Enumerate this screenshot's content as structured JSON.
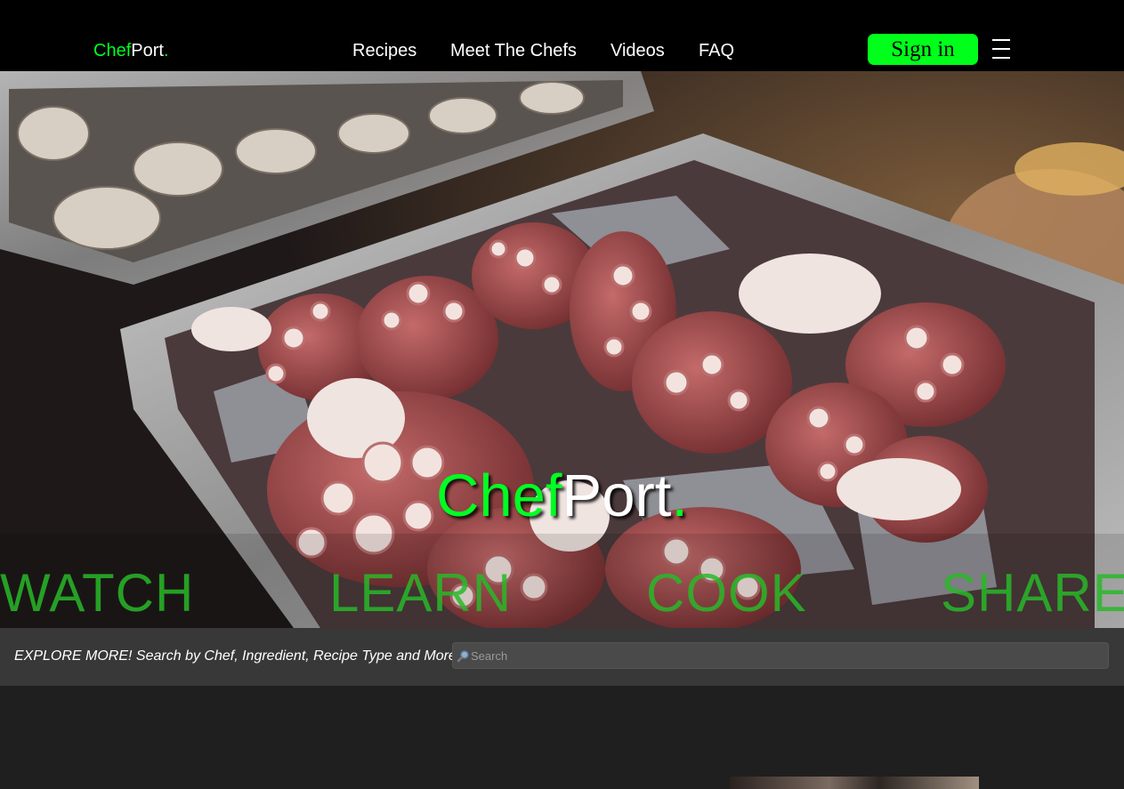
{
  "header": {
    "logo": {
      "part1": "Chef",
      "part2": "Port",
      "dot": "."
    },
    "nav": [
      {
        "label": "Recipes"
      },
      {
        "label": "Meet The Chefs"
      },
      {
        "label": "Videos"
      },
      {
        "label": "FAQ"
      }
    ],
    "signin_label": "Sign in"
  },
  "hero": {
    "title": {
      "part1": "Chef",
      "part2": "Port",
      "dot": "."
    },
    "words": [
      "WATCH",
      "LEARN",
      "COOK",
      "SHARE"
    ]
  },
  "explore": {
    "text": "EXPLORE MORE! Search by Chef, Ingredient, Recipe Type and More!",
    "search_placeholder": "Search",
    "search_value": ""
  },
  "colors": {
    "accent": "#00ff22",
    "header_bg": "#000000",
    "page_bg": "#1f1f1f",
    "explore_bg": "#383838"
  },
  "icons": {
    "menu": "hamburger-icon",
    "search": "magnifier-icon"
  }
}
